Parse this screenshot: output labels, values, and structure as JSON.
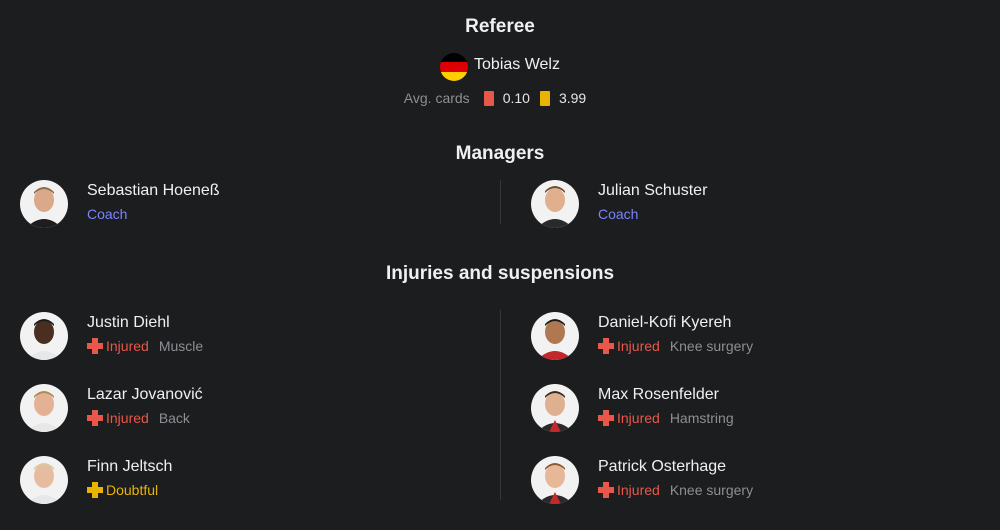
{
  "referee": {
    "title": "Referee",
    "flag_icon": "germany-flag-icon",
    "name": "Tobias Welz",
    "avg_label": "Avg. cards",
    "red_avg": "0.10",
    "yellow_avg": "3.99",
    "colors": {
      "red_card": "#e8574a",
      "yellow_card": "#e8b400"
    }
  },
  "managers": {
    "title": "Managers",
    "home": {
      "name": "Sebastian Hoeneß",
      "role": "Coach"
    },
    "away": {
      "name": "Julian Schuster",
      "role": "Coach"
    }
  },
  "injuries": {
    "title": "Injuries and suspensions",
    "home": [
      {
        "name": "Justin Diehl",
        "status": "Injured",
        "reason": "Muscle"
      },
      {
        "name": "Lazar Jovanović",
        "status": "Injured",
        "reason": "Back"
      },
      {
        "name": "Finn Jeltsch",
        "status": "Doubtful",
        "reason": ""
      }
    ],
    "away": [
      {
        "name": "Daniel-Kofi Kyereh",
        "status": "Injured",
        "reason": "Knee surgery"
      },
      {
        "name": "Max Rosenfelder",
        "status": "Injured",
        "reason": "Hamstring"
      },
      {
        "name": "Patrick Osterhage",
        "status": "Injured",
        "reason": "Knee surgery"
      }
    ]
  },
  "colors": {
    "accent_role": "#7b83ff",
    "injured": "#e8574a",
    "doubtful": "#e8b400"
  }
}
